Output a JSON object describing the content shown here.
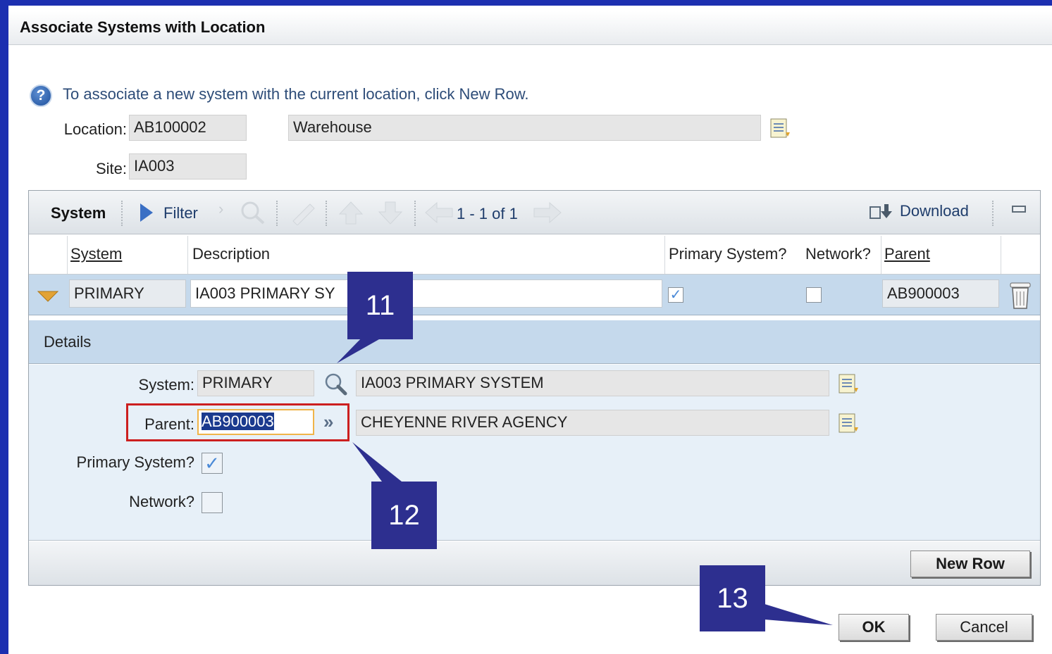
{
  "dialog": {
    "title": "Associate Systems with Location",
    "help_text": "To associate a new system with the current location, click New Row."
  },
  "location": {
    "label": "Location:",
    "code": "AB100002",
    "description": "Warehouse"
  },
  "site": {
    "label": "Site:",
    "code": "IA003"
  },
  "toolbar": {
    "title": "System",
    "filter_label": "Filter",
    "pagination": "1 - 1 of 1",
    "download_label": "Download"
  },
  "table": {
    "columns": [
      "System",
      "Description",
      "Primary System?",
      "Network?",
      "Parent"
    ],
    "rows": [
      {
        "system": "PRIMARY",
        "description": "IA003 PRIMARY SY",
        "primary": true,
        "network": false,
        "parent": "AB900003"
      }
    ]
  },
  "details": {
    "header": "Details",
    "system_label": "System:",
    "system_value": "PRIMARY",
    "system_description": "IA003 PRIMARY SYSTEM",
    "parent_label": "Parent:",
    "parent_value": "AB900003",
    "parent_description": "CHEYENNE RIVER AGENCY",
    "primary_label": "Primary System?",
    "primary_checked": true,
    "network_label": "Network?",
    "network_checked": false
  },
  "buttons": {
    "new_row": "New Row",
    "ok": "OK",
    "cancel": "Cancel"
  },
  "callouts": [
    "11",
    "12",
    "13"
  ],
  "colors": {
    "callout": "#2d2f8f",
    "highlight_box": "#cc1f1f",
    "background": "#1c2fb0"
  }
}
